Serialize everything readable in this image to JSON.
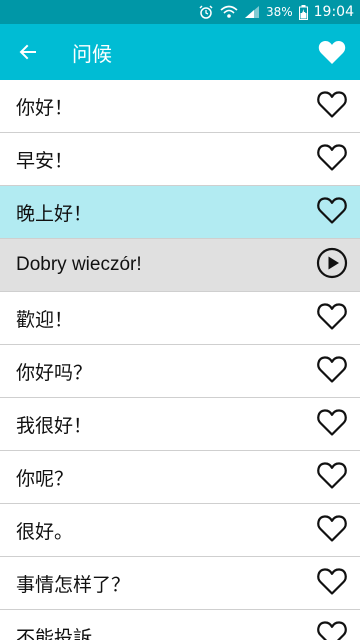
{
  "status_bar": {
    "battery": "38%",
    "time": "19:04"
  },
  "app_bar": {
    "title": "问候"
  },
  "colors": {
    "status_bar": "#0097a7",
    "app_bar": "#00bcd4",
    "selected_row": "#b2ebf2",
    "translation_row": "#e0e0e0"
  },
  "list": {
    "items": [
      {
        "text": "你好！",
        "icon": "heart-outline-icon"
      },
      {
        "text": "早安！",
        "icon": "heart-outline-icon"
      },
      {
        "text": "晚上好！",
        "icon": "heart-outline-icon",
        "selected": true
      },
      {
        "text": "Dobry wieczór!",
        "icon": "play-icon",
        "translation": true
      },
      {
        "text": "歡迎！",
        "icon": "heart-outline-icon"
      },
      {
        "text": "你好吗？",
        "icon": "heart-outline-icon"
      },
      {
        "text": "我很好！",
        "icon": "heart-outline-icon"
      },
      {
        "text": "你呢？",
        "icon": "heart-outline-icon"
      },
      {
        "text": "很好。",
        "icon": "heart-outline-icon"
      },
      {
        "text": "事情怎样了？",
        "icon": "heart-outline-icon"
      },
      {
        "text": "不能投訴",
        "icon": "heart-outline-icon"
      }
    ]
  }
}
